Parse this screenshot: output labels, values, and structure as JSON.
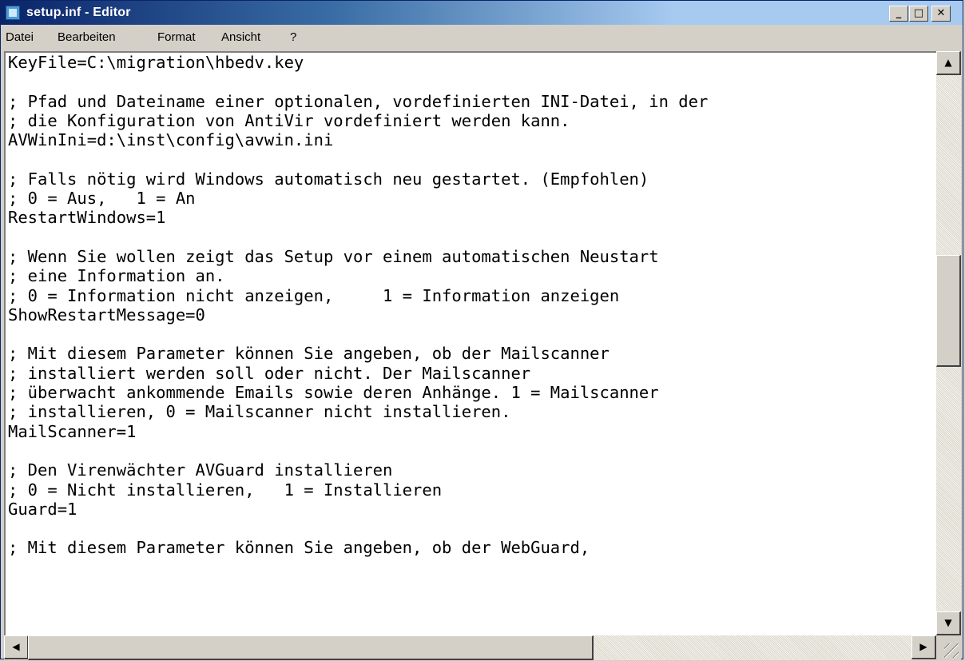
{
  "window": {
    "title": "setup.inf - Editor",
    "app_icon": "notepad-icon",
    "minimize_label": "_",
    "maximize_label": "□",
    "close_label": "✕"
  },
  "menu": {
    "items": [
      "Datei",
      "Bearbeiten",
      "Format",
      "Ansicht",
      "?"
    ]
  },
  "document": {
    "lines": [
      "KeyFile=C:\\migration\\hbedv.key",
      "",
      "; Pfad und Dateiname einer optionalen, vordefinierten INI-Datei, in der",
      "; die Konfiguration von AntiVir vordefiniert werden kann.",
      "AVWinIni=d:\\inst\\config\\avwin.ini",
      "",
      "; Falls nötig wird Windows automatisch neu gestartet. (Empfohlen)",
      "; 0 = Aus,   1 = An",
      "RestartWindows=1",
      "",
      "; Wenn Sie wollen zeigt das Setup vor einem automatischen Neustart",
      "; eine Information an.",
      "; 0 = Information nicht anzeigen,     1 = Information anzeigen",
      "ShowRestartMessage=0",
      "",
      "; Mit diesem Parameter können Sie angeben, ob der Mailscanner",
      "; installiert werden soll oder nicht. Der Mailscanner",
      "; überwacht ankommende Emails sowie deren Anhänge. 1 = Mailscanner",
      "; installieren, 0 = Mailscanner nicht installieren.",
      "MailScanner=1",
      "",
      "; Den Virenwächter AVGuard installieren",
      "; 0 = Nicht installieren,   1 = Installieren",
      "Guard=1",
      "",
      "; Mit diesem Parameter können Sie angeben, ob der WebGuard,"
    ]
  },
  "scrollbars": {
    "up_arrow": "▲",
    "down_arrow": "▼",
    "left_arrow": "◀",
    "right_arrow": "▶",
    "vertical_position": 0.35,
    "horizontal_position": 0.0
  }
}
